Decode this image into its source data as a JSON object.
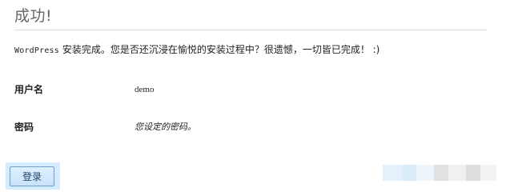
{
  "header": {
    "title": "成功!"
  },
  "message": {
    "product": "WordPress",
    "text": " 安装完成。您是否还沉浸在愉悦的安装过程中？很遗憾，一切皆已完成！ :)"
  },
  "fields": {
    "username": {
      "label": "用户名",
      "value": "demo"
    },
    "password": {
      "label": "密码",
      "value": "您设定的密码。"
    }
  },
  "actions": {
    "login_label": "登录"
  },
  "colors": {
    "primary_button_border": "#6d9fd3",
    "primary_button_bg": "#c8e2fb",
    "highlight": "#d5ebff"
  }
}
